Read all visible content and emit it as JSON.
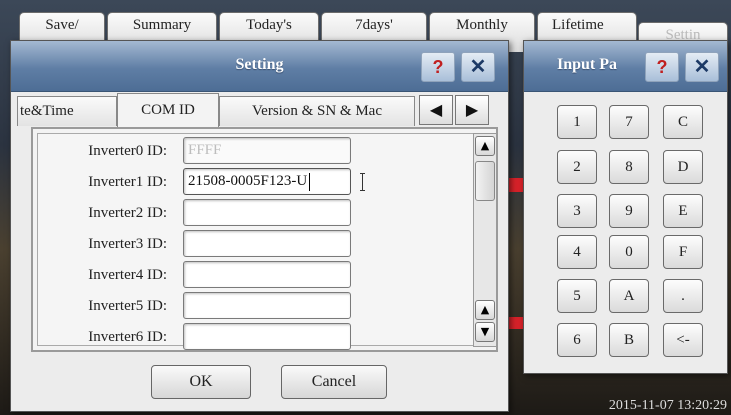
{
  "background_tabs": [
    "Save/",
    "Summary",
    "Today's",
    "7days'",
    "Monthly",
    "Lifetime",
    "Settin"
  ],
  "datetime": "2015-11-07 13:20:29",
  "setting_dialog": {
    "title": "Setting",
    "help_label": "?",
    "close_label": "✕",
    "tabs": [
      "te&Time",
      "COM ID",
      "Version & SN & Mac"
    ],
    "active_tab": "COM ID",
    "prev_arrow": "◀",
    "next_arrow": "▶",
    "rows": [
      {
        "label": "Inverter0 ID:",
        "value": "FFFF"
      },
      {
        "label": "Inverter1 ID:",
        "value": "21508-0005F123-U"
      },
      {
        "label": "Inverter2 ID:",
        "value": ""
      },
      {
        "label": "Inverter3 ID:",
        "value": ""
      },
      {
        "label": "Inverter4 ID:",
        "value": ""
      },
      {
        "label": "Inverter5 ID:",
        "value": ""
      },
      {
        "label": "Inverter6 ID:",
        "value": ""
      }
    ],
    "scroll_up": "▲",
    "scroll_down": "▼",
    "ok_label": "OK",
    "cancel_label": "Cancel"
  },
  "input_panel": {
    "title": "Input Pa",
    "help_label": "?",
    "close_label": "✕",
    "keys": [
      [
        "1",
        "7",
        "C"
      ],
      [
        "2",
        "8",
        "D"
      ],
      [
        "3",
        "9",
        "E"
      ],
      [
        "4",
        "0",
        "F"
      ],
      [
        "5",
        "A",
        "."
      ],
      [
        "6",
        "B",
        "<-"
      ]
    ]
  },
  "colors": {
    "title_bar": "#5f7ea5",
    "help_icon": "#c02020",
    "status_red": "#d8222a",
    "status_green": "#2ea84a"
  }
}
